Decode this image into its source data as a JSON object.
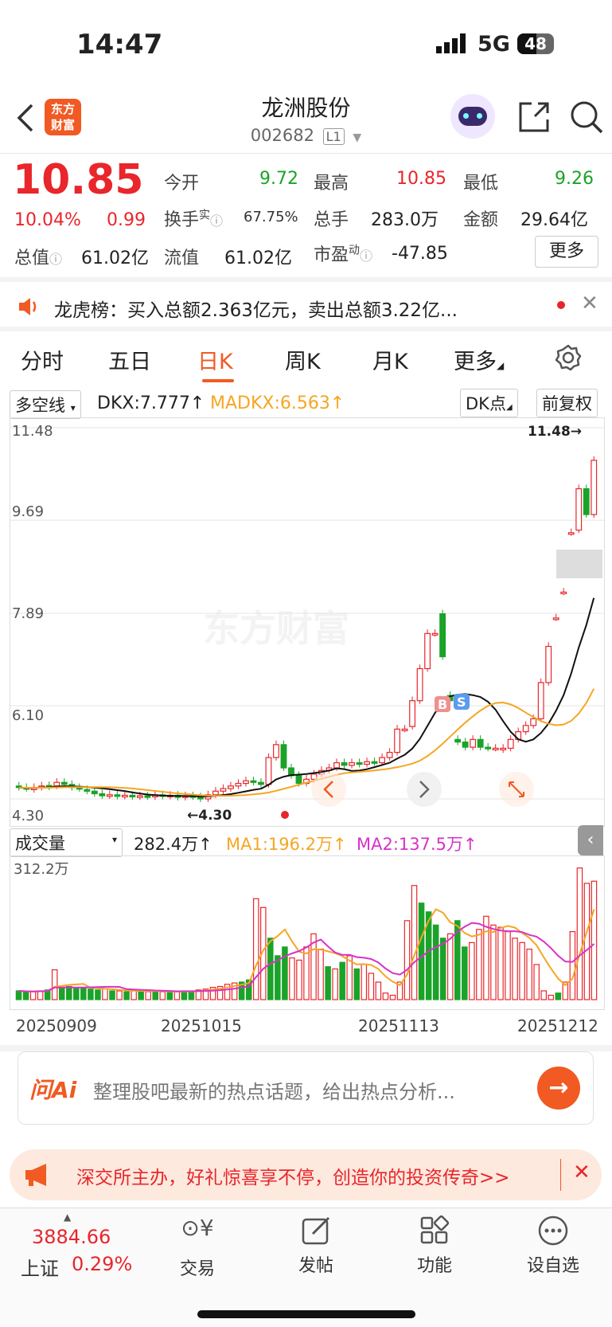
{
  "status_bar": {
    "time": "14:47",
    "network": "5G",
    "battery": "48"
  },
  "header": {
    "stock_name": "龙洲股份",
    "stock_code": "002682",
    "level": "L1",
    "logo_line1": "东方",
    "logo_line2": "财富"
  },
  "quote": {
    "price": "10.85",
    "change_pct": "10.04%",
    "change": "0.99",
    "open_label": "今开",
    "open": "9.72",
    "high_label": "最高",
    "high": "10.85",
    "low_label": "最低",
    "low": "9.26",
    "turnover_label": "换手",
    "turnover_sup": "实",
    "turnover": "67.75%",
    "volume_label": "总手",
    "volume": "283.0万",
    "amount_label": "金额",
    "amount": "29.64亿",
    "mktcap_label": "总值",
    "mktcap": "61.02亿",
    "float_label": "流值",
    "float": "61.02亿",
    "pe_label": "市盈",
    "pe_sup": "动",
    "pe": "-47.85",
    "more_button": "更多"
  },
  "news": {
    "text": "龙虎榜：买入总额2.363亿元，卖出总额3.22亿..."
  },
  "tabs": [
    "分时",
    "五日",
    "日K",
    "周K",
    "月K",
    "更多"
  ],
  "active_tab": "日K",
  "indicator_bar": {
    "selector": "多空线",
    "dkx": "DKX:7.777↑",
    "madkx": "MADKX:6.563↑",
    "dk_button": "DK点",
    "adjust_button": "前复权"
  },
  "volume_bar": {
    "selector": "成交量",
    "vol": "282.4万↑",
    "ma1": "MA1:196.2万↑",
    "ma2": "MA2:137.5万↑"
  },
  "chart_data": [
    {
      "type": "candlestick",
      "y_ticks": [
        "11.48",
        "9.69",
        "7.89",
        "6.10",
        "4.30"
      ],
      "ylim": [
        4.3,
        11.48
      ],
      "annotations": [
        "11.48→",
        "←4.30"
      ],
      "signals": [
        "B",
        "S"
      ],
      "watermark": "东方财富",
      "candles": [
        {
          "o": 4.55,
          "c": 4.52
        },
        {
          "o": 4.52,
          "c": 4.5
        },
        {
          "o": 4.48,
          "c": 4.52
        },
        {
          "o": 4.52,
          "c": 4.55
        },
        {
          "o": 4.56,
          "c": 4.53
        },
        {
          "o": 4.55,
          "c": 4.62
        },
        {
          "o": 4.62,
          "c": 4.58
        },
        {
          "o": 4.58,
          "c": 4.52
        },
        {
          "o": 4.52,
          "c": 4.5
        },
        {
          "o": 4.48,
          "c": 4.45
        },
        {
          "o": 4.45,
          "c": 4.4
        },
        {
          "o": 4.4,
          "c": 4.36
        },
        {
          "o": 4.36,
          "c": 4.38
        },
        {
          "o": 4.38,
          "c": 4.35
        },
        {
          "o": 4.35,
          "c": 4.37
        },
        {
          "o": 4.37,
          "c": 4.34
        },
        {
          "o": 4.34,
          "c": 4.36
        },
        {
          "o": 4.36,
          "c": 4.34
        },
        {
          "o": 4.34,
          "c": 4.38
        },
        {
          "o": 4.38,
          "c": 4.35
        },
        {
          "o": 4.35,
          "c": 4.37
        },
        {
          "o": 4.37,
          "c": 4.33
        },
        {
          "o": 4.33,
          "c": 4.36
        },
        {
          "o": 4.36,
          "c": 4.34
        },
        {
          "o": 4.34,
          "c": 4.3
        },
        {
          "o": 4.3,
          "c": 4.38
        },
        {
          "o": 4.38,
          "c": 4.45
        },
        {
          "o": 4.45,
          "c": 4.5
        },
        {
          "o": 4.5,
          "c": 4.55
        },
        {
          "o": 4.55,
          "c": 4.6
        },
        {
          "o": 4.6,
          "c": 4.65
        },
        {
          "o": 4.65,
          "c": 4.62
        },
        {
          "o": 4.62,
          "c": 4.58
        },
        {
          "o": 4.58,
          "c": 5.1
        },
        {
          "o": 5.1,
          "c": 5.35
        },
        {
          "o": 5.35,
          "c": 4.9
        },
        {
          "o": 4.9,
          "c": 4.75
        },
        {
          "o": 4.75,
          "c": 4.6
        },
        {
          "o": 4.6,
          "c": 4.68
        },
        {
          "o": 4.68,
          "c": 4.78
        },
        {
          "o": 4.78,
          "c": 4.85
        },
        {
          "o": 4.85,
          "c": 4.9
        },
        {
          "o": 4.9,
          "c": 5.0
        },
        {
          "o": 5.0,
          "c": 4.95
        },
        {
          "o": 4.95,
          "c": 5.0
        },
        {
          "o": 5.0,
          "c": 4.97
        },
        {
          "o": 4.97,
          "c": 5.02
        },
        {
          "o": 5.02,
          "c": 5.0
        },
        {
          "o": 5.0,
          "c": 5.1
        },
        {
          "o": 5.1,
          "c": 5.2
        },
        {
          "o": 5.2,
          "c": 5.65
        },
        {
          "o": 5.65,
          "c": 5.65
        },
        {
          "o": 5.7,
          "c": 6.2
        },
        {
          "o": 6.2,
          "c": 6.82
        },
        {
          "o": 6.82,
          "c": 7.5
        },
        {
          "o": 7.5,
          "c": 7.5
        },
        {
          "o": 7.88,
          "c": 7.05
        },
        {
          "o": 6.3,
          "c": 6.2
        },
        {
          "o": 5.45,
          "c": 5.4
        },
        {
          "o": 5.4,
          "c": 5.3
        },
        {
          "o": 5.3,
          "c": 5.45
        },
        {
          "o": 5.45,
          "c": 5.3
        },
        {
          "o": 5.3,
          "c": 5.28
        },
        {
          "o": 5.28,
          "c": 5.28
        },
        {
          "o": 5.25,
          "c": 5.28
        },
        {
          "o": 5.28,
          "c": 5.45
        },
        {
          "o": 5.45,
          "c": 5.6
        },
        {
          "o": 5.6,
          "c": 5.72
        },
        {
          "o": 5.72,
          "c": 5.85
        },
        {
          "o": 5.85,
          "c": 6.55
        },
        {
          "o": 6.55,
          "c": 7.25
        },
        {
          "o": 7.8,
          "c": 7.8
        },
        {
          "o": 8.3,
          "c": 8.3
        },
        {
          "o": 9.45,
          "c": 9.45
        },
        {
          "o": 9.5,
          "c": 10.3
        },
        {
          "o": 10.3,
          "c": 9.8
        },
        {
          "o": 9.8,
          "c": 10.85
        }
      ]
    },
    {
      "type": "bar",
      "title": "成交量",
      "y_ticks": [
        "312.2万"
      ],
      "x_ticks": [
        "20250909",
        "20251015",
        "20251113",
        "20251212"
      ],
      "ylim": [
        0,
        312.2
      ],
      "values": [
        20,
        18,
        18,
        20,
        22,
        68,
        28,
        30,
        25,
        28,
        24,
        22,
        25,
        20,
        20,
        18,
        20,
        22,
        18,
        20,
        18,
        16,
        18,
        20,
        20,
        22,
        24,
        28,
        30,
        35,
        38,
        40,
        45,
        230,
        210,
        140,
        100,
        120,
        95,
        90,
        120,
        150,
        115,
        75,
        70,
        85,
        100,
        70,
        80,
        60,
        40,
        15,
        10,
        40,
        180,
        260,
        220,
        200,
        170,
        140,
        150,
        180,
        120,
        130,
        160,
        190,
        170,
        165,
        155,
        140,
        130,
        115,
        80,
        20,
        10,
        15,
        40,
        155,
        300,
        265,
        270
      ]
    }
  ],
  "ai_prompt": {
    "brand": "问Ai",
    "placeholder": "整理股吧最新的热点话题，给出热点分析..."
  },
  "promo_banner": {
    "text": "深交所主办，好礼惊喜享不停，创造你的投资传奇>>"
  },
  "bottom_bar": {
    "index_value": "3884.66",
    "index_name": "上证",
    "index_change": "0.29%",
    "items": [
      {
        "label": "交易",
        "icon": "yuan-icon"
      },
      {
        "label": "发帖",
        "icon": "edit-icon"
      },
      {
        "label": "功能",
        "icon": "grid-icon"
      },
      {
        "label": "设自选",
        "icon": "more-icon"
      }
    ]
  }
}
